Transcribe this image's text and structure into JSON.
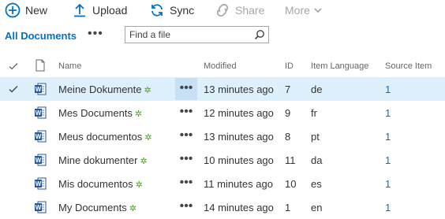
{
  "toolbar": {
    "new_label": "New",
    "upload_label": "Upload",
    "sync_label": "Sync",
    "share_label": "Share",
    "more_label": "More"
  },
  "view": {
    "name": "All Documents",
    "more": "•••",
    "search_placeholder": "Find a file"
  },
  "columns": {
    "name": "Name",
    "modified": "Modified",
    "id": "ID",
    "language": "Item Language",
    "source": "Source Item"
  },
  "rows": [
    {
      "name": "Meine Dokumente",
      "modified": "13 minutes ago",
      "id": "7",
      "language": "de",
      "source": "1",
      "selected": true
    },
    {
      "name": "Mes Documents",
      "modified": "12 minutes ago",
      "id": "9",
      "language": "fr",
      "source": "1",
      "selected": false
    },
    {
      "name": "Meus documentos",
      "modified": "13 minutes ago",
      "id": "8",
      "language": "pt",
      "source": "1",
      "selected": false
    },
    {
      "name": "Mine dokumenter",
      "modified": "10 minutes ago",
      "id": "11",
      "language": "da",
      "source": "1",
      "selected": false
    },
    {
      "name": "Mis documentos",
      "modified": "11 minutes ago",
      "id": "10",
      "language": "es",
      "source": "1",
      "selected": false
    },
    {
      "name": "My Documents",
      "modified": "14 minutes ago",
      "id": "1",
      "language": "en",
      "source": "1",
      "selected": false
    }
  ],
  "colors": {
    "accent": "#0072c6",
    "selected_row": "#def0fb",
    "new_mark": "#4aa524"
  }
}
